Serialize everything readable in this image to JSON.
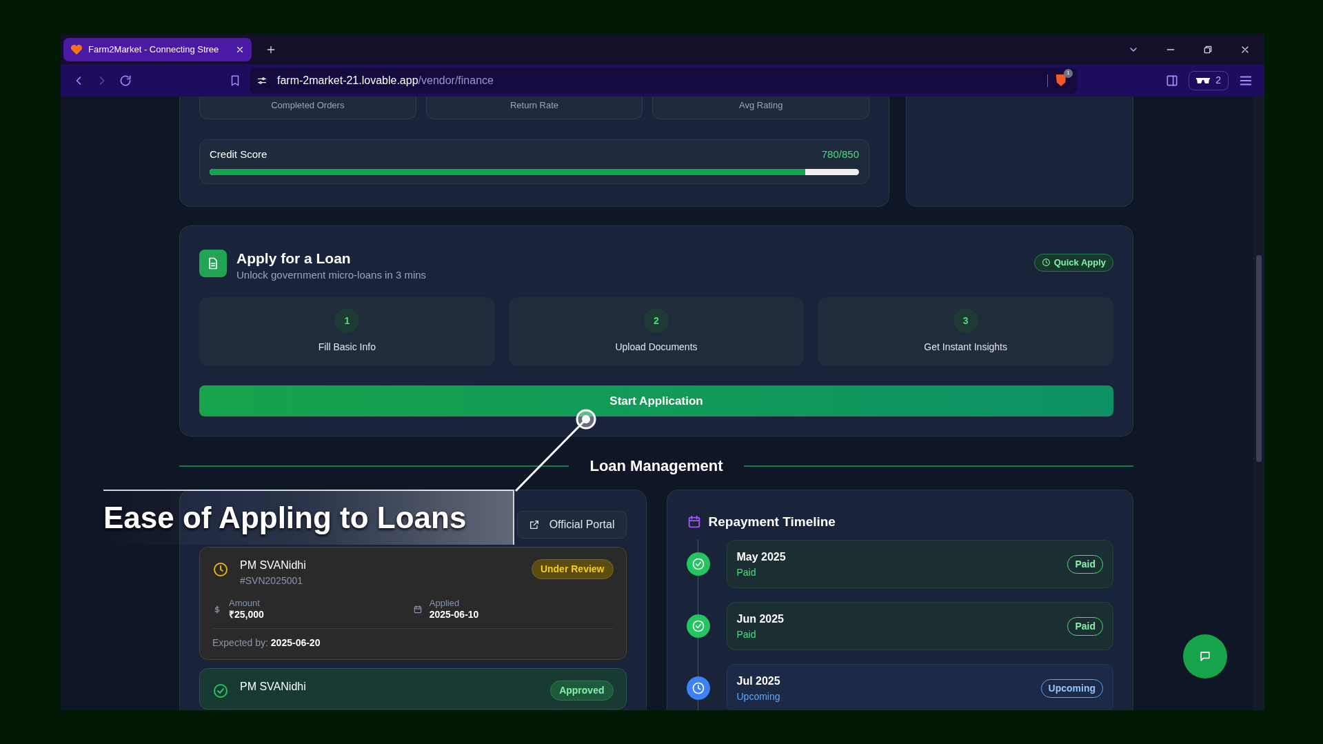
{
  "browser": {
    "tab_title": "Farm2Market - Connecting Stree",
    "url_host": "farm-2market-21.lovable.app",
    "url_path": "/vendor/finance",
    "shields_count": "1",
    "private_windows": "2"
  },
  "stats": [
    "Completed Orders",
    "Return Rate",
    "Avg Rating"
  ],
  "credit_score": {
    "label": "Credit Score",
    "value": "780/850",
    "level": 0.917
  },
  "loan_apply": {
    "title": "Apply for a Loan",
    "subtitle": "Unlock government micro-loans in 3 mins",
    "badge": "Quick Apply",
    "steps": [
      {
        "number": "1",
        "label": "Fill Basic Info"
      },
      {
        "number": "2",
        "label": "Upload Documents"
      },
      {
        "number": "3",
        "label": "Get Instant Insights"
      }
    ],
    "button": "Start Application"
  },
  "section_heading": "Loan Management",
  "loan_tracker": {
    "portal_button": "Official Portal",
    "applications": [
      {
        "kind": "review",
        "name": "PM SVANidhi",
        "id": "#SVN2025001",
        "status": "Under Review",
        "amount_label": "Amount",
        "amount": "₹25,000",
        "applied_label": "Applied",
        "applied": "2025-06-10",
        "expected_label": "Expected by:",
        "expected": "2025-06-20"
      },
      {
        "kind": "approved",
        "name": "PM SVANidhi",
        "status": "Approved"
      }
    ]
  },
  "repayment": {
    "title": "Repayment Timeline",
    "items": [
      {
        "kind": "paid",
        "month": "May 2025",
        "status_text": "Paid",
        "badge": "Paid"
      },
      {
        "kind": "paid",
        "month": "Jun 2025",
        "status_text": "Paid",
        "badge": "Paid"
      },
      {
        "kind": "upcoming",
        "month": "Jul 2025",
        "status_text": "Upcoming",
        "badge": "Upcoming"
      }
    ]
  },
  "caption": "Ease of Appling to Loans"
}
